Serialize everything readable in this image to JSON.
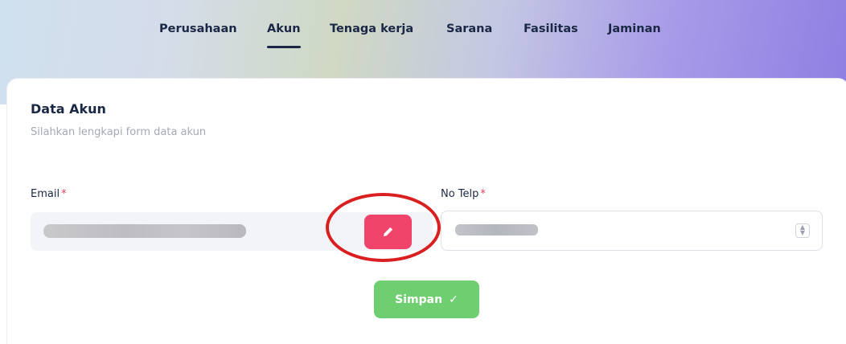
{
  "tabs": [
    {
      "label": "Perusahaan",
      "active": false
    },
    {
      "label": "Akun",
      "active": true
    },
    {
      "label": "Tenaga kerja",
      "active": false
    },
    {
      "label": "Sarana",
      "active": false
    },
    {
      "label": "Fasilitas",
      "active": false
    },
    {
      "label": "Jaminan",
      "active": false
    }
  ],
  "form": {
    "title": "Data Akun",
    "subtitle": "Silahkan lengkapi form data akun",
    "email_label": "Email",
    "phone_label": "No Telp",
    "required_mark": "*",
    "save_label": "Simpan",
    "save_icon": "✓"
  },
  "colors": {
    "accent_edit": "#f0446b",
    "save_green": "#6fcf70",
    "required": "#ef3d5e",
    "annotation_circle": "#d91f1f"
  },
  "icons": {
    "edit": "pencil-icon",
    "save": "check-icon",
    "spinner": "number-spinner-icon"
  }
}
